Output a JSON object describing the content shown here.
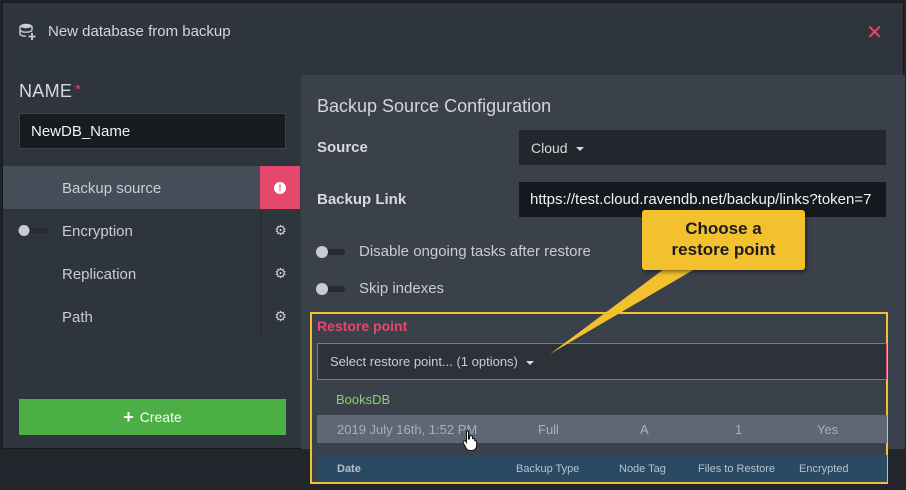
{
  "window": {
    "title": "New database from backup",
    "close_symbol": "✕"
  },
  "name_section": {
    "label": "NAME",
    "required_mark": "*",
    "value": "NewDB_Name"
  },
  "menu": {
    "items": [
      {
        "label": "Backup source",
        "state": "active-alert"
      },
      {
        "label": "Encryption",
        "toggle": false
      },
      {
        "label": "Replication"
      },
      {
        "label": "Path"
      }
    ]
  },
  "create_button": {
    "label": "Create",
    "icon": "plus-icon"
  },
  "config": {
    "title": "Backup Source Configuration",
    "source_label": "Source",
    "source_value": "Cloud",
    "backup_link_label": "Backup Link",
    "backup_link_value": "https://test.cloud.ravendb.net/backup/links?token=7",
    "disable_tasks_label": "Disable ongoing tasks after restore",
    "skip_indexes_label": "Skip indexes"
  },
  "restore": {
    "title": "Restore point",
    "select_placeholder": "Select restore point... (1 options)",
    "group_name": "BooksDB",
    "row": {
      "date": "2019 July 16th, 1:52 PM",
      "backup_type": "Full",
      "node_tag": "A",
      "files": "1",
      "encrypted": "Yes"
    },
    "headers": {
      "date": "Date",
      "backup_type": "Backup Type",
      "node_tag": "Node Tag",
      "files": "Files to Restore",
      "encrypted": "Encrypted"
    }
  },
  "callout": {
    "line1": "Choose a",
    "line2": "restore point"
  },
  "colors": {
    "accent": "#e5486d",
    "success": "#4caf46",
    "highlight": "#f3c02e",
    "group": "#8bd26d"
  }
}
